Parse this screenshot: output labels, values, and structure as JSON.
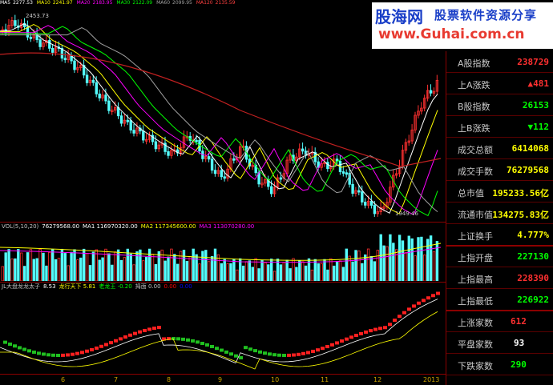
{
  "main_chart": {
    "ma_legend": [
      {
        "label": "MA5",
        "value": "2277.53",
        "color": "#ffffff"
      },
      {
        "label": "MA10",
        "value": "2241.97",
        "color": "#ffff00"
      },
      {
        "label": "MA20",
        "value": "2183.95",
        "color": "#ff00ff"
      },
      {
        "label": "MA30",
        "value": "2122.09",
        "color": "#00ff00"
      },
      {
        "label": "MA60",
        "value": "2099.95",
        "color": "#a0a0a0"
      },
      {
        "label": "MA120",
        "value": "2135.59",
        "color": "#ff4040"
      }
    ],
    "high_label": "2453.73",
    "low_label": "1949.46"
  },
  "volume_chart": {
    "legend": [
      {
        "text": "VOL(5,10,20)",
        "color": "#c0c0c0"
      },
      {
        "text": "76279568.00",
        "color": "#ffffff"
      },
      {
        "text": "MA1 116970320.00",
        "color": "#ffffff"
      },
      {
        "text": "MA2 117345600.00",
        "color": "#ffff00"
      },
      {
        "text": "MA3 113070280.00",
        "color": "#ff00ff"
      }
    ]
  },
  "indicator_chart": {
    "legend": [
      {
        "text": "JL大盘龙龙太子",
        "color": "#c0c0c0"
      },
      {
        "text": "8.53",
        "color": "#ffffff"
      },
      {
        "text": "龙行天下 5.81",
        "color": "#ffff00"
      },
      {
        "text": "老龙王 -0.20",
        "color": "#00ff00"
      },
      {
        "text": "拇面 0.00",
        "color": "#c0c0c0"
      },
      {
        "text": "0.00",
        "color": "#ff0000"
      },
      {
        "text": "0.00",
        "color": "#0000ff"
      }
    ]
  },
  "x_axis": {
    "labels": [
      "6",
      "7",
      "8",
      "9",
      "10",
      "11",
      "12",
      "2013"
    ]
  },
  "banner": {
    "logo_text": "股海网",
    "slogan": "股票软件资源分享",
    "url": "www.Guhai.com.cn"
  },
  "stats": [
    {
      "label": "A股指数",
      "value": "238729",
      "color": "#ff3030"
    },
    {
      "label": "上A涨跌",
      "value": "▲481",
      "color": "#ff3030"
    },
    {
      "label": "B股指数",
      "value": "26153",
      "color": "#00ff00"
    },
    {
      "label": "上B涨跌",
      "value": "▼112",
      "color": "#00ff00"
    },
    {
      "label": "成交总额",
      "value": "6414068",
      "color": "#ffff00"
    },
    {
      "label": "成交手数",
      "value": "76279568",
      "color": "#ffff00"
    },
    {
      "label": "总市值",
      "value": "195233.56亿",
      "color": "#ffff00"
    },
    {
      "label": "流通市值",
      "value": "134275.83亿",
      "color": "#ffff00"
    },
    {
      "label": "上证换手",
      "value": "4.777%",
      "color": "#ffff00"
    },
    {
      "label": "上指开盘",
      "value": "227130",
      "color": "#00ff00"
    },
    {
      "label": "上指最高",
      "value": "228390",
      "color": "#ff3030"
    },
    {
      "label": "上指最低",
      "value": "226922",
      "color": "#00ff00"
    },
    {
      "label": "上涨家数",
      "value": "612",
      "color": "#ff3030"
    },
    {
      "label": "平盘家数",
      "value": "93",
      "color": "#ffffff"
    },
    {
      "label": "下跌家数",
      "value": "290",
      "color": "#00ff00"
    }
  ],
  "colors": {
    "up": "#ff3030",
    "down": "#54fcfc",
    "grid": "#8b0000"
  }
}
